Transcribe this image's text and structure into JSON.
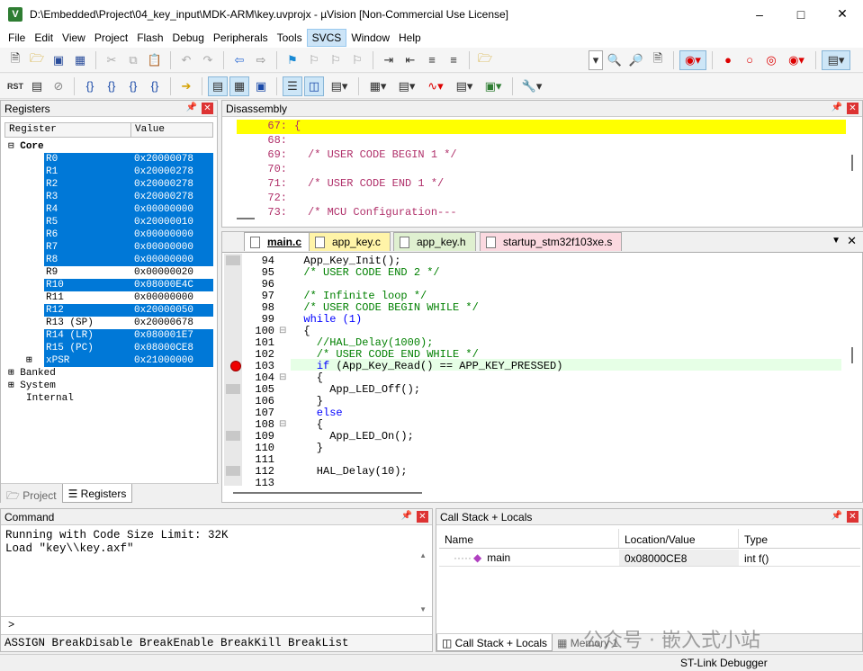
{
  "window": {
    "title": "D:\\Embedded\\Project\\04_key_input\\MDK-ARM\\key.uvprojx - µVision  [Non-Commercial Use License]",
    "icon": "uvision-icon"
  },
  "menu": [
    "File",
    "Edit",
    "View",
    "Project",
    "Flash",
    "Debug",
    "Peripherals",
    "Tools",
    "SVCS",
    "Window",
    "Help"
  ],
  "registers": {
    "title": "Registers",
    "col_register": "Register",
    "col_value": "Value",
    "group_core": "Core",
    "rows": [
      [
        "R0",
        "0x20000078"
      ],
      [
        "R1",
        "0x20000278"
      ],
      [
        "R2",
        "0x20000278"
      ],
      [
        "R3",
        "0x20000278"
      ],
      [
        "R4",
        "0x00000000"
      ],
      [
        "R5",
        "0x20000010"
      ],
      [
        "R6",
        "0x00000000"
      ],
      [
        "R7",
        "0x00000000"
      ],
      [
        "R8",
        "0x00000000"
      ],
      [
        "R9",
        "0x00000020"
      ],
      [
        "R10",
        "0x08000E4C"
      ],
      [
        "R11",
        "0x00000000"
      ],
      [
        "R12",
        "0x20000050"
      ],
      [
        "R13 (SP)",
        "0x20000678"
      ],
      [
        "R14 (LR)",
        "0x080001E7"
      ],
      [
        "R15 (PC)",
        "0x08000CE8"
      ],
      [
        "xPSR",
        "0x21000000"
      ]
    ],
    "groups": [
      "Banked",
      "System",
      "Internal"
    ],
    "tab_project": "Project",
    "tab_registers": "Registers"
  },
  "disassembly": {
    "title": "Disassembly",
    "lines": [
      [
        "67:",
        "{"
      ],
      [
        "68:",
        ""
      ],
      [
        "69:",
        "/* USER CODE BEGIN 1 */"
      ],
      [
        "70:",
        ""
      ],
      [
        "71:",
        "/* USER CODE END 1 */"
      ],
      [
        "72:",
        ""
      ],
      [
        "73:",
        "/* MCU Configuration---"
      ]
    ]
  },
  "editor": {
    "tabs": [
      "main.c",
      "app_key.c",
      "app_key.h",
      "startup_stm32f103xe.s"
    ],
    "lines": [
      [
        "94",
        "  App_Key_Init();"
      ],
      [
        "95",
        "  /* USER CODE END 2 */"
      ],
      [
        "96",
        ""
      ],
      [
        "97",
        "  /* Infinite loop */"
      ],
      [
        "98",
        "  /* USER CODE BEGIN WHILE */"
      ],
      [
        "99",
        "  while (1)"
      ],
      [
        "100",
        "  {"
      ],
      [
        "101",
        "    //HAL_Delay(1000);"
      ],
      [
        "102",
        "    /* USER CODE END WHILE */"
      ],
      [
        "103",
        "    if (App_Key_Read() == APP_KEY_PRESSED)"
      ],
      [
        "104",
        "    {"
      ],
      [
        "105",
        "      App_LED_Off();"
      ],
      [
        "106",
        "    }"
      ],
      [
        "107",
        "    else"
      ],
      [
        "108",
        "    {"
      ],
      [
        "109",
        "      App_LED_On();"
      ],
      [
        "110",
        "    }"
      ],
      [
        "111",
        ""
      ],
      [
        "112",
        "    HAL_Delay(10);"
      ],
      [
        "113",
        ""
      ]
    ]
  },
  "command": {
    "title": "Command",
    "output": [
      "Running with Code Size Limit: 32K",
      "Load \"key\\\\key.axf\""
    ],
    "prompt": ">",
    "hints": "ASSIGN BreakDisable BreakEnable BreakKill BreakList"
  },
  "callstack": {
    "title": "Call Stack + Locals",
    "col_name": "Name",
    "col_location": "Location/Value",
    "col_type": "Type",
    "row_name": "main",
    "row_location": "0x08000CE8",
    "row_type": "int f()",
    "tab_callstack": "Call Stack + Locals",
    "tab_memory": "Memory 1"
  },
  "status": {
    "debugger": "ST-Link Debugger"
  },
  "watermark": "公众号 · 嵌入式小站"
}
